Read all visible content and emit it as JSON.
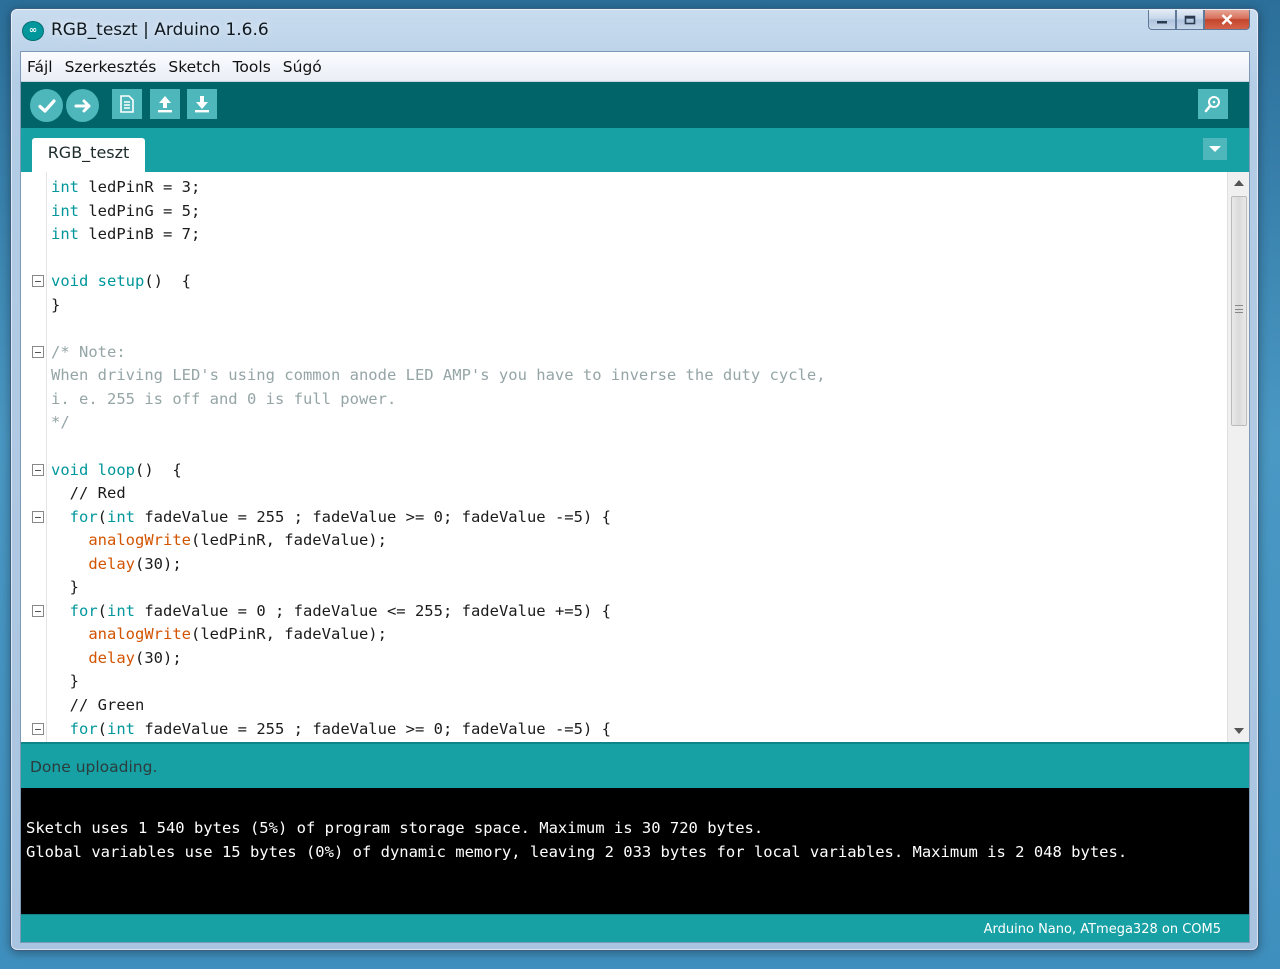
{
  "window": {
    "title": "RGB_teszt | Arduino 1.6.6",
    "icon": "arduino-logo-icon",
    "controls": [
      "minimize-icon",
      "maximize-icon",
      "close-icon"
    ]
  },
  "menu": [
    "Fájl",
    "Szerkesztés",
    "Sketch",
    "Tools",
    "Súgó"
  ],
  "toolbar": {
    "buttons": [
      "verify-icon",
      "upload-icon",
      "new-icon",
      "open-icon",
      "save-icon"
    ],
    "right": "serial-monitor-icon",
    "accent": "#006468",
    "button_color": "#4db7bb"
  },
  "tabs": {
    "active": "RGB_teszt",
    "menu_icon": "tab-menu-chevron-icon"
  },
  "editor": {
    "colors": {
      "keyword": "#00979c",
      "function": "#d35400",
      "comment": "#95a5a6"
    },
    "lines": [
      [
        {
          "t": "int",
          "c": "kw"
        },
        {
          "t": " ledPinR = 3;",
          "c": "plain"
        }
      ],
      [
        {
          "t": "int",
          "c": "kw"
        },
        {
          "t": " ledPinG = 5;",
          "c": "plain"
        }
      ],
      [
        {
          "t": "int",
          "c": "kw"
        },
        {
          "t": " ledPinB = 7;",
          "c": "plain"
        }
      ],
      [],
      [
        {
          "t": "void",
          "c": "kw"
        },
        {
          "t": " ",
          "c": "plain"
        },
        {
          "t": "setup",
          "c": "kw"
        },
        {
          "t": "()  {",
          "c": "plain"
        }
      ],
      [
        {
          "t": "}",
          "c": "plain"
        }
      ],
      [],
      [
        {
          "t": "/* Note:",
          "c": "cm"
        }
      ],
      [
        {
          "t": "When driving LED's using common anode LED AMP's you have to inverse the duty cycle,",
          "c": "cm"
        }
      ],
      [
        {
          "t": "i. e. 255 is off and 0 is full power.",
          "c": "cm"
        }
      ],
      [
        {
          "t": "*/",
          "c": "cm"
        }
      ],
      [],
      [
        {
          "t": "void",
          "c": "kw"
        },
        {
          "t": " ",
          "c": "plain"
        },
        {
          "t": "loop",
          "c": "kw"
        },
        {
          "t": "()  {",
          "c": "plain"
        }
      ],
      [
        {
          "t": "  // Red",
          "c": "plain"
        }
      ],
      [
        {
          "t": "  ",
          "c": "plain"
        },
        {
          "t": "for",
          "c": "kw"
        },
        {
          "t": "(",
          "c": "plain"
        },
        {
          "t": "int",
          "c": "kw"
        },
        {
          "t": " fadeValue = 255 ; fadeValue >= 0; fadeValue -=5) {",
          "c": "plain"
        }
      ],
      [
        {
          "t": "    ",
          "c": "plain"
        },
        {
          "t": "analogWrite",
          "c": "fn"
        },
        {
          "t": "(ledPinR, fadeValue);",
          "c": "plain"
        }
      ],
      [
        {
          "t": "    ",
          "c": "plain"
        },
        {
          "t": "delay",
          "c": "fn"
        },
        {
          "t": "(30);",
          "c": "plain"
        }
      ],
      [
        {
          "t": "  }",
          "c": "plain"
        }
      ],
      [
        {
          "t": "  ",
          "c": "plain"
        },
        {
          "t": "for",
          "c": "kw"
        },
        {
          "t": "(",
          "c": "plain"
        },
        {
          "t": "int",
          "c": "kw"
        },
        {
          "t": " fadeValue = 0 ; fadeValue <= 255; fadeValue +=5) {",
          "c": "plain"
        }
      ],
      [
        {
          "t": "    ",
          "c": "plain"
        },
        {
          "t": "analogWrite",
          "c": "fn"
        },
        {
          "t": "(ledPinR, fadeValue);",
          "c": "plain"
        }
      ],
      [
        {
          "t": "    ",
          "c": "plain"
        },
        {
          "t": "delay",
          "c": "fn"
        },
        {
          "t": "(30);",
          "c": "plain"
        }
      ],
      [
        {
          "t": "  }",
          "c": "plain"
        }
      ],
      [
        {
          "t": "  // Green",
          "c": "plain"
        }
      ],
      [
        {
          "t": "  ",
          "c": "plain"
        },
        {
          "t": "for",
          "c": "kw"
        },
        {
          "t": "(",
          "c": "plain"
        },
        {
          "t": "int",
          "c": "kw"
        },
        {
          "t": " fadeValue = 255 ; fadeValue >= 0; fadeValue -=5) {",
          "c": "plain"
        }
      ]
    ],
    "fold_lines": [
      4,
      7,
      12,
      14,
      18,
      23
    ]
  },
  "status": {
    "message": "Done uploading."
  },
  "console": {
    "lines": [
      "Sketch uses 1 540 bytes (5%) of program storage space. Maximum is 30 720 bytes.",
      "Global variables use 15 bytes (0%) of dynamic memory, leaving 2 033 bytes for local variables. Maximum is 2 048 bytes."
    ]
  },
  "footer": {
    "board": "Arduino Nano, ATmega328 on COM5"
  }
}
